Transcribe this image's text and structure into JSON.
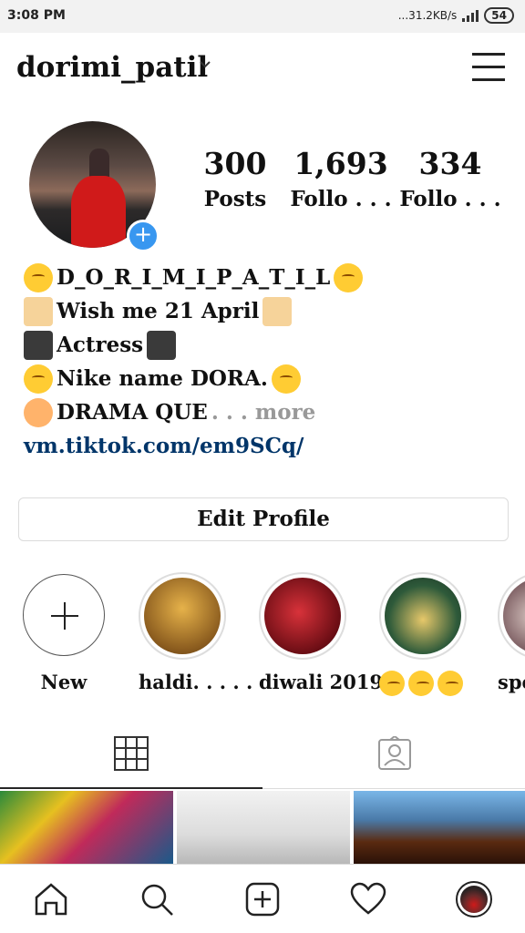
{
  "status_bar": {
    "time": "3:08 PM",
    "speed": "...31.2KB/s",
    "battery": "54"
  },
  "header": {
    "username": "dorimi_patil"
  },
  "stats": [
    {
      "value": "300",
      "label": "Posts"
    },
    {
      "value": "1,693",
      "label": "Follo . . ."
    },
    {
      "value": "334",
      "label": "Follo . . ."
    }
  ],
  "bio": {
    "line1": "D_O_R_I_M_I_P_A_T_I_L",
    "line2": "Wish me 21 April",
    "line3": "Actress",
    "line4": "Nike name DORA.",
    "line5": "DRAMA QUE",
    "more": ". . . more",
    "link": "vm.tiktok.com/em9SCq/"
  },
  "edit_profile": "Edit Profile",
  "highlights": [
    {
      "label": "New"
    },
    {
      "label": "haldi. . . . ."
    },
    {
      "label": "diwali 2019"
    },
    {
      "label": ""
    },
    {
      "label": "spec"
    }
  ],
  "colors": {
    "accent": "#3897f0",
    "link": "#003569",
    "border": "#dbdbdb"
  },
  "icons": [
    "home-icon",
    "search-icon",
    "add-post-icon",
    "heart-icon",
    "profile-avatar-icon",
    "grid-icon",
    "tagged-icon",
    "menu-icon"
  ]
}
